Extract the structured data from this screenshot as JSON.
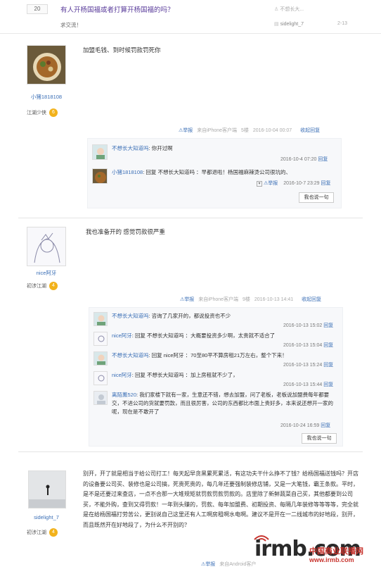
{
  "thread": {
    "reply_count": "20",
    "title": "有人开杨国福或者打算开杨国福的吗？",
    "subtitle": "求交流！",
    "author": "不想长大...",
    "last_replier": "sidelight_7",
    "last_date": "2-13"
  },
  "posts": [
    {
      "author": "小猪1818108",
      "rank": "江湖少侠",
      "rank_level": "6",
      "content": "加盟毛钱、到时候罚款罚死你",
      "meta": {
        "report": "举报",
        "source": "来自iPhone客户端",
        "floor": "5楼",
        "time": "2016-10-04 00:07",
        "collapse": "收起回复"
      },
      "replies": [
        {
          "name": "不想长大知道吗",
          "text": "你开过啊",
          "time": "2016-10-4 07:20",
          "action": "回复"
        },
        {
          "name": "小猪1818108",
          "text": "回复 不想长大知道吗 ：早都退啦！杨国福麻辣烫公司很坑的、",
          "time": "2016-10-7 23:29",
          "action": "回复",
          "report": "举报"
        }
      ],
      "say_button": "我也说一句"
    },
    {
      "author": "nice阿牙",
      "rank": "初涉江湖",
      "rank_level": "4",
      "content": "我也准备开的 感觉罚款很严重",
      "meta": {
        "report": "举报",
        "source": "来自iPhone客户端",
        "floor": "9楼",
        "time": "2016-10-13 14:41",
        "collapse": "收起回复"
      },
      "replies": [
        {
          "name": "不想长大知道吗",
          "text": "咨询了几家开的，都说投资也不少",
          "time": "2016-10-13 15:02",
          "action": "回复"
        },
        {
          "name": "nice阿牙",
          "text": "回复 不想长大知道吗 ：大概要投资多少啊，太贵就不适合了",
          "time": "2016-10-13 15:04",
          "action": "回复"
        },
        {
          "name": "不想长大知道吗",
          "text": "回复 nice阿牙 ：70至80平不算房租21万左右，整个下来！",
          "time": "2016-10-13 15:24",
          "action": "回复"
        },
        {
          "name": "nice阿牙",
          "text": "回复 不想长大知道吗 ：加上房租就不少了，",
          "time": "2016-10-13 15:44",
          "action": "回复"
        },
        {
          "name": "离陌薰520",
          "text": "我们家楼下就有一家，生意还不错，想去加盟，问了老板，老板说加盟费每年都要交，不进公司的货就要罚款，而且很厉害，公司的东西都比市面上贵好多，本来说还想开一家的呢，现在是不敢开了",
          "time": "2016-10-24 16:59",
          "action": "回复"
        }
      ],
      "say_button": "我也说一句"
    },
    {
      "author": "sidelight_7",
      "rank": "初涉江湖",
      "rank_level": "4",
      "content": "别开，开了就是相当于给公司打工！每天起早贪黑累死累活，有这功夫干什么挣不了钱？给杨国福送钱吗？开店的设备要公司买、装修也是公司搞，死贵死贵的，每几年还要强制装修店铺，又是一大笔钱，霸王条款。平时，是不是还要过来查店，一点不合那一大堆规矩就罚款罚款罚款的。店里除了新鲜蔬菜自己买，其他都要到公司买，不能外购，查到又得罚款！一年到头赚的，罚款、每年加盟费、初期投资、每隔几年装修等等等等，完全就是在给杨国福打劳苦公，更别说自己这里还有人工啊房租啊水电啊。建议不是开在一二线城市的好地段，别开，而且既然开在好地段了，为什么不开别的？",
      "meta": {
        "report": "举报",
        "source": "来自Android客户"
      }
    }
  ],
  "watermark": {
    "logo": "irmb.com",
    "cn": "中国商业联播网",
    "url": "www.irmb.com"
  }
}
